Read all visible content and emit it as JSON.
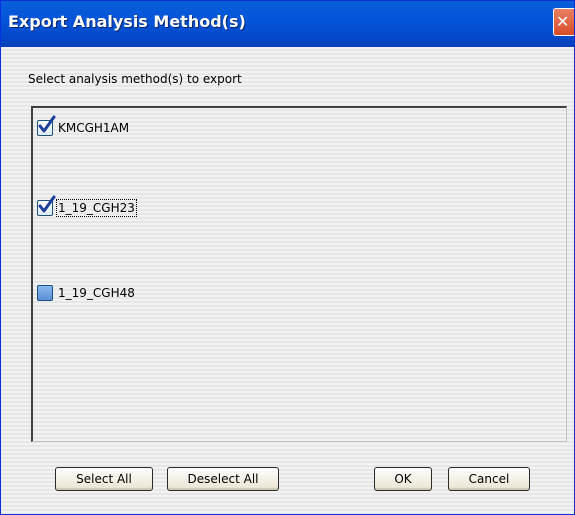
{
  "window": {
    "title": "Export Analysis Method(s)",
    "close_icon": "close-icon"
  },
  "instruction": "Select analysis method(s) to export",
  "methods": [
    {
      "label": "KMCGH1AM",
      "checked": true
    },
    {
      "label": "1_19_CGH23",
      "checked": true,
      "focused": true
    },
    {
      "label": "1_19_CGH48",
      "checked": false
    }
  ],
  "buttons": {
    "select_all": "Select All",
    "deselect_all": "Deselect All",
    "ok": "OK",
    "cancel": "Cancel"
  },
  "colors": {
    "titlebar": "#0454d9",
    "close_button": "#d94d2a",
    "checkmark": "#1c3f9c"
  }
}
